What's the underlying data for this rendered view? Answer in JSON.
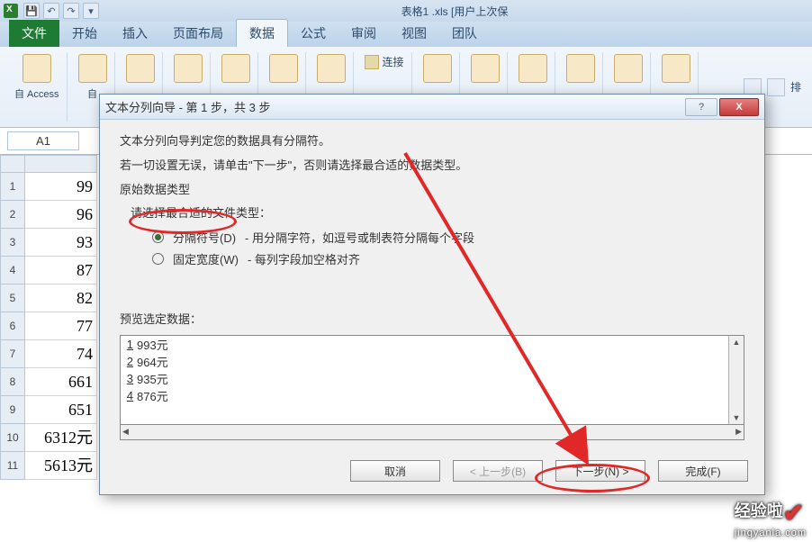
{
  "title": "表格1 .xls [用户上次保",
  "tabs": {
    "file": "文件",
    "home": "开始",
    "insert": "插入",
    "pagelayout": "页面布局",
    "data": "数据",
    "formulas": "公式",
    "review": "审阅",
    "view": "视图",
    "team": "团队"
  },
  "ribbon": {
    "from_access": "自 Access",
    "from": "自",
    "connections": "连接",
    "sort": "排"
  },
  "namebox": "A1",
  "rows": [
    "1",
    "2",
    "3",
    "4",
    "5",
    "6",
    "7",
    "8",
    "9",
    "10",
    "11"
  ],
  "cells": [
    "99",
    "96",
    "93",
    "87",
    "82",
    "77",
    "74",
    "661",
    "651",
    "6312元",
    "5613元"
  ],
  "dialog": {
    "title": "文本分列向导 - 第 1 步，共 3 步",
    "line1": "文本分列向导判定您的数据具有分隔符。",
    "line2": "若一切设置无误，请单击\"下一步\"，否则请选择最合适的数据类型。",
    "group": "原始数据类型",
    "subgroup": "请选择最合适的文件类型：",
    "opt1": "分隔符号(D)",
    "opt1_hint": "- 用分隔字符，如逗号或制表符分隔每个字段",
    "opt2": "固定宽度(W)",
    "opt2_hint": "- 每列字段加空格对齐",
    "preview_label": "预览选定数据：",
    "preview": [
      "993元",
      "964元",
      "935元",
      "876元"
    ],
    "btn_cancel": "取消",
    "btn_back": "< 上一步(B)",
    "btn_next": "下一步(N) >",
    "btn_finish": "完成(F)"
  },
  "watermark": {
    "main": "经验啦",
    "sub": "jingyanla.com"
  }
}
